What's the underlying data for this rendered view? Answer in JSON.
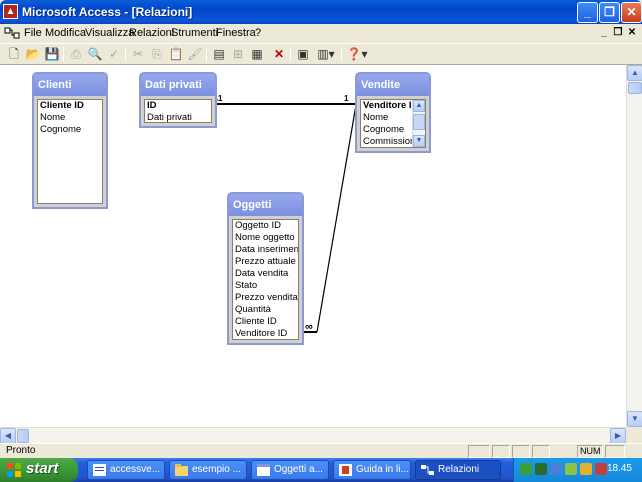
{
  "window": {
    "title": "Microsoft Access - [Relazioni]",
    "minimize_glyph": "_",
    "restore_glyph": "❐",
    "close_glyph": "✕"
  },
  "menubar": {
    "items": [
      "File",
      "Modifica",
      "Visualizza",
      "Relazioni",
      "Strumenti",
      "Finestra",
      "?"
    ],
    "mdi_minimize": "_",
    "mdi_restore": "❐",
    "mdi_close": "✕"
  },
  "toolbar": {
    "icons": [
      "new-icon",
      "open-icon",
      "save-icon",
      "print-icon",
      "print-preview-icon",
      "spelling-icon",
      "cut-icon",
      "copy-icon",
      "paste-icon",
      "format-painter-icon",
      "show-table-icon",
      "show-direct-icon",
      "show-all-icon",
      "delete-icon",
      "new-object-icon",
      "help-icon"
    ]
  },
  "tables": {
    "clienti": {
      "title": "Clienti",
      "fields": [
        "Cliente ID",
        "Nome",
        "Cognome"
      ],
      "primary": [
        0
      ]
    },
    "dati_privati": {
      "title": "Dati privati",
      "fields": [
        "ID",
        "Dati privati"
      ],
      "primary": [
        0
      ]
    },
    "vendite": {
      "title": "Vendite",
      "fields": [
        "Venditore ID",
        "Nome",
        "Cognome",
        "Commissione %"
      ],
      "primary": [
        0
      ]
    },
    "oggetti": {
      "title": "Oggetti",
      "fields": [
        "Oggetto ID",
        "Nome oggetto",
        "Data inserimento",
        "Prezzo attuale",
        "Data vendita",
        "Stato",
        "Prezzo vendita",
        "Quantità",
        "Cliente ID",
        "Venditore ID"
      ],
      "primary": []
    }
  },
  "relations": {
    "one_label": "1",
    "many_label": "∞"
  },
  "statusbar": {
    "text": "Pronto",
    "num": "NUM"
  },
  "taskbar": {
    "start_label": "start",
    "tasks": [
      "accessve...",
      "esempio ...",
      "Oggetti a...",
      "Guida in li...",
      "Relazioni"
    ],
    "clock": "18.45"
  }
}
